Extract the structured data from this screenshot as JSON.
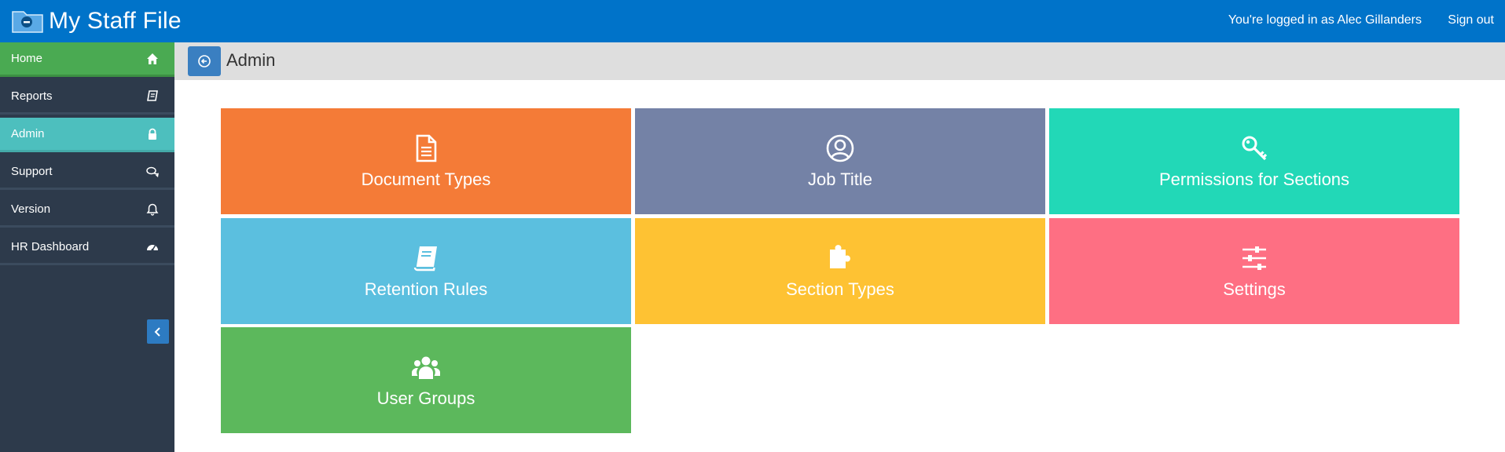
{
  "app": {
    "title": "My Staff File"
  },
  "header": {
    "logged_in_text": "You're logged in as Alec Gillanders",
    "signout_label": "Sign out"
  },
  "sidebar": {
    "items": [
      {
        "label": "Home",
        "icon": "home-icon"
      },
      {
        "label": "Reports",
        "icon": "book-icon"
      },
      {
        "label": "Admin",
        "icon": "lock-icon"
      },
      {
        "label": "Support",
        "icon": "comments-icon"
      },
      {
        "label": "Version",
        "icon": "bell-icon"
      },
      {
        "label": "HR Dashboard",
        "icon": "dashboard-icon"
      }
    ],
    "active": "Admin"
  },
  "page": {
    "title": "Admin"
  },
  "tiles": [
    {
      "label": "Document Types",
      "icon": "document-icon",
      "color": "#f47b37"
    },
    {
      "label": "Job Title",
      "icon": "user-circle-icon",
      "color": "#7482a6"
    },
    {
      "label": "Permissions for Sections",
      "icon": "key-icon",
      "color": "#22d8b7"
    },
    {
      "label": "Retention Rules",
      "icon": "book-icon",
      "color": "#5bbfdf"
    },
    {
      "label": "Section Types",
      "icon": "puzzle-icon",
      "color": "#fec233"
    },
    {
      "label": "Settings",
      "icon": "sliders-icon",
      "color": "#fe6f83"
    },
    {
      "label": "User Groups",
      "icon": "users-icon",
      "color": "#5cb85c"
    }
  ],
  "colors": {
    "topbar": "#0073c9",
    "sidebar": "#2d3a4b",
    "home": "#4aaa52",
    "active": "#4dbfbe",
    "pagebar": "#dedede"
  }
}
